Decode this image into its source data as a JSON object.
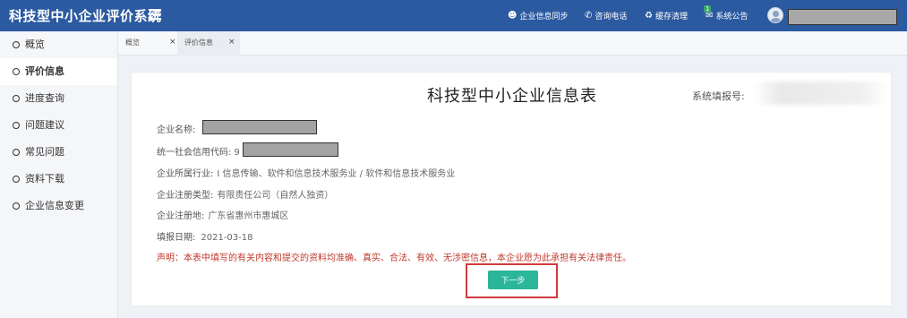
{
  "app": {
    "title": "科技型中小企业评价系统"
  },
  "topnav": {
    "sync_label": "企业信息同步",
    "hotline_label": "咨询电话",
    "cache_label": "缓存清理",
    "notice_label": "系统公告",
    "notice_count": "1"
  },
  "sidebar": {
    "items": [
      {
        "label": "概览"
      },
      {
        "label": "评价信息"
      },
      {
        "label": "进度查询"
      },
      {
        "label": "问题建议"
      },
      {
        "label": "常见问题"
      },
      {
        "label": "资料下载"
      },
      {
        "label": "企业信息变更"
      }
    ],
    "active_index": 1
  },
  "tabs": [
    {
      "label": "概览",
      "close": "×"
    },
    {
      "label": "评价信息",
      "close": "×"
    }
  ],
  "form": {
    "title": "科技型中小企业信息表",
    "report_no_label": "系统填报号:",
    "company_name_label": "企业名称:",
    "credit_code_label": "统一社会信用代码:",
    "credit_code_prefix": "9",
    "industry_label": "企业所属行业:",
    "industry_value": "I 信息传输、软件和信息技术服务业 / 软件和信息技术服务业",
    "reg_type_label": "企业注册类型:",
    "reg_type_value": "有限责任公司（自然人独资）",
    "reg_place_label": "企业注册地:",
    "reg_place_value": "广东省惠州市惠城区",
    "report_date_label": "填报日期:",
    "report_date_value": "2021-03-18",
    "declaration": "声明：本表中填写的有关内容和提交的资料均准确、真实、合法、有效、无涉密信息，本企业愿为此承担有关法律责任。",
    "next_button": "下一步"
  },
  "colors": {
    "topbar": "#2c5aa0",
    "button": "#2bb69a",
    "declaration": "#c0392b",
    "highlight": "#d43a3a"
  }
}
